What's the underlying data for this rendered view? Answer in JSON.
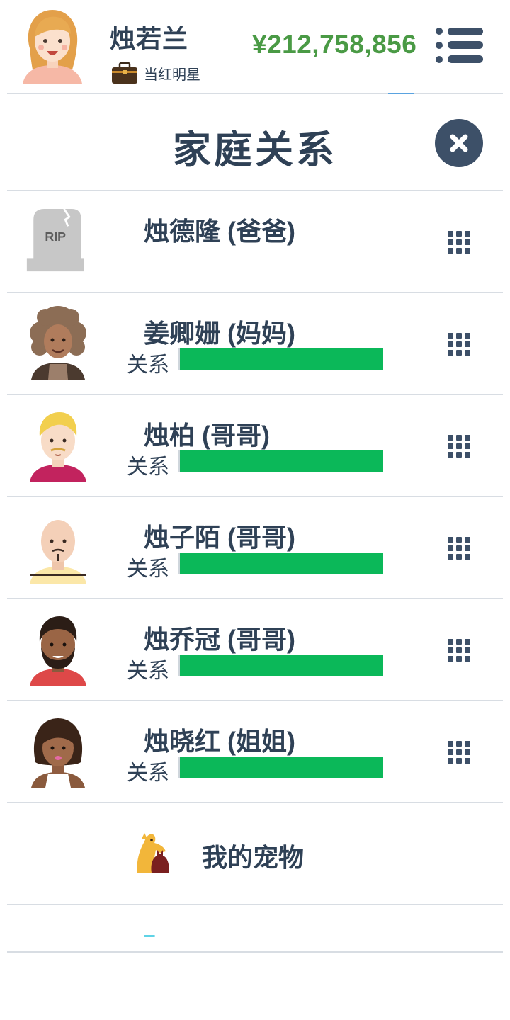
{
  "header": {
    "player_name": "烛若兰",
    "job_title": "当红明星",
    "money": "¥212,758,856"
  },
  "page": {
    "title": "家庭关系"
  },
  "family": [
    {
      "name": "烛德隆 (爸爸)",
      "deceased": true,
      "rip_text": "RIP"
    },
    {
      "name": "姜卿姗 (妈妈)",
      "relation_label": "关系",
      "relation_level": 1.0
    },
    {
      "name": "烛柏 (哥哥)",
      "relation_label": "关系",
      "relation_level": 1.0
    },
    {
      "name": "烛子陌 (哥哥)",
      "relation_label": "关系",
      "relation_level": 1.0
    },
    {
      "name": "烛乔冠 (哥哥)",
      "relation_label": "关系",
      "relation_level": 1.0
    },
    {
      "name": "烛晓红 (姐姐)",
      "relation_label": "关系",
      "relation_level": 1.0
    }
  ],
  "pets": {
    "label": "我的宠物"
  },
  "colors": {
    "text": "#2f4156",
    "money": "#4a9a45",
    "relation_bar": "#0bb859",
    "close_button": "#3d5068"
  }
}
